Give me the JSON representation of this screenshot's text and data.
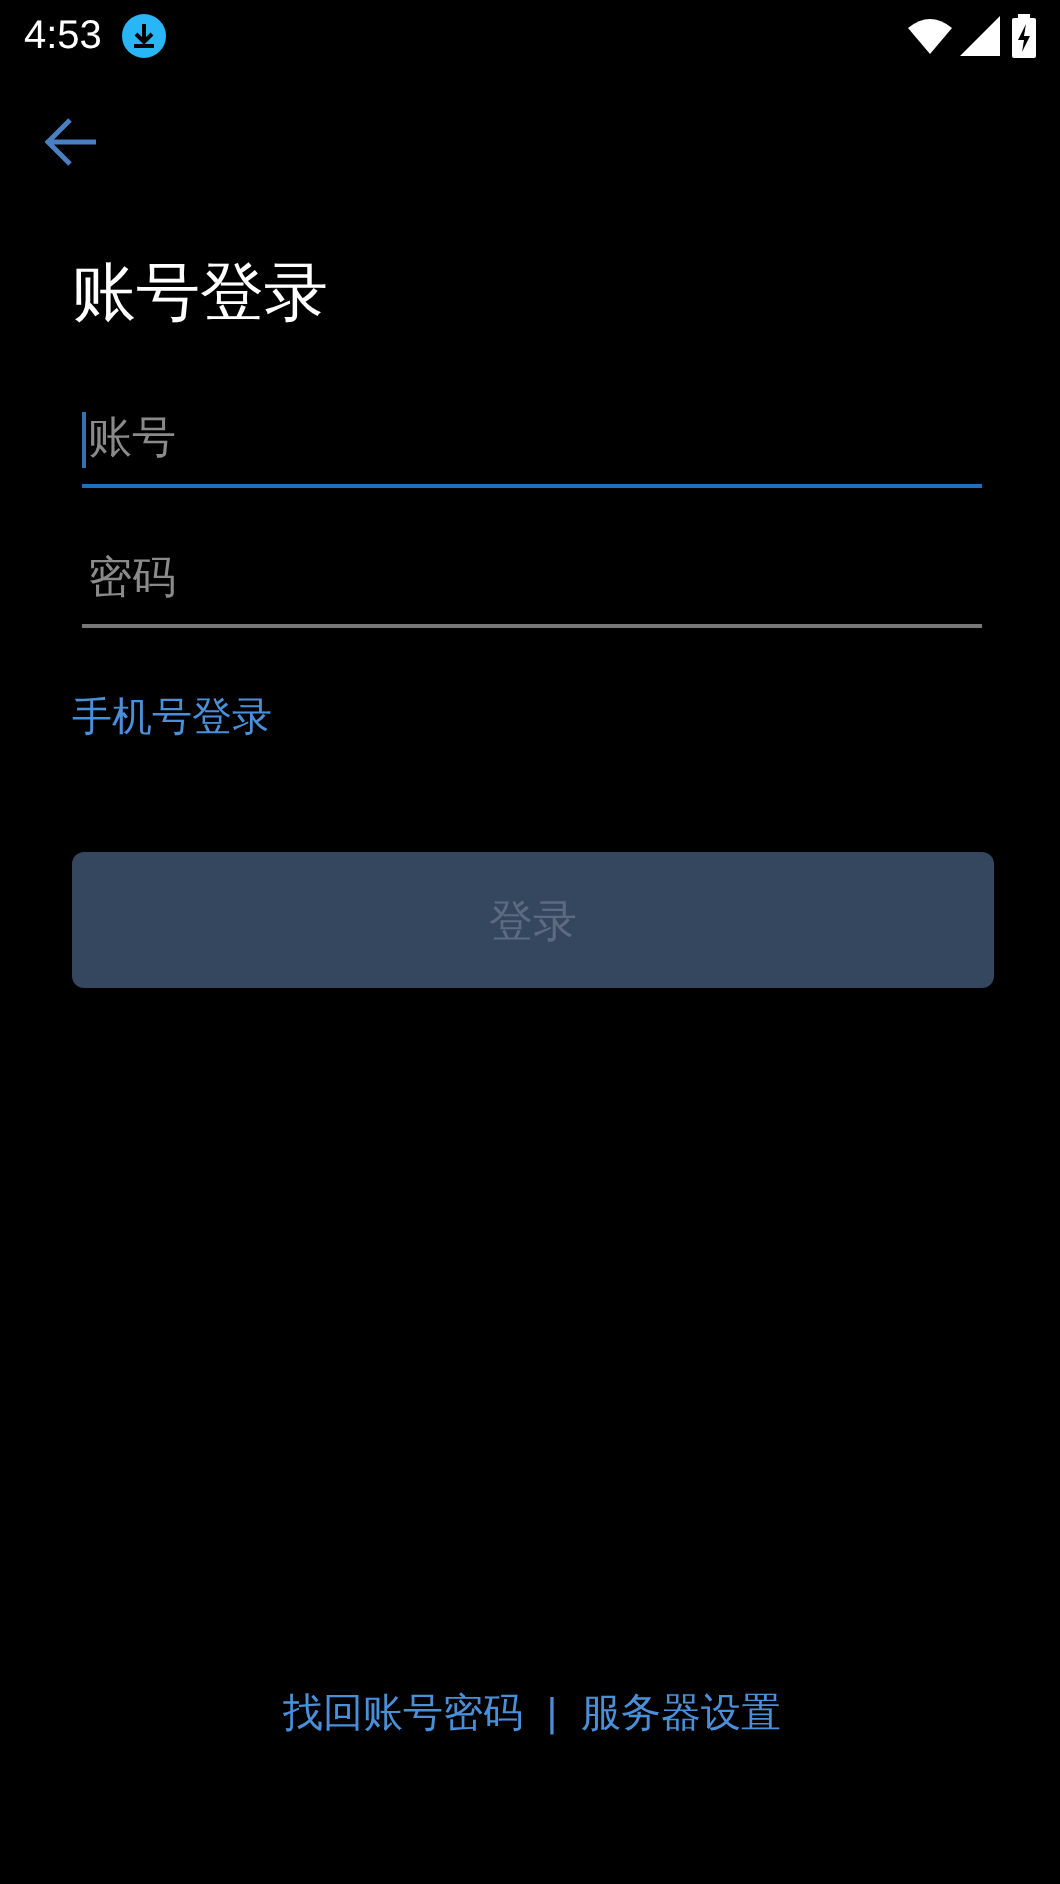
{
  "status_bar": {
    "time": "4:53"
  },
  "title": "账号登录",
  "fields": [
    {
      "placeholder": "账号",
      "focused": true
    },
    {
      "placeholder": "密码",
      "focused": false
    }
  ],
  "alt_login_link": "手机号登录",
  "login_button": {
    "label": "登录",
    "disabled": true
  },
  "footer": {
    "links": [
      "找回账号密码",
      "服务器设置"
    ],
    "separator": "|"
  }
}
